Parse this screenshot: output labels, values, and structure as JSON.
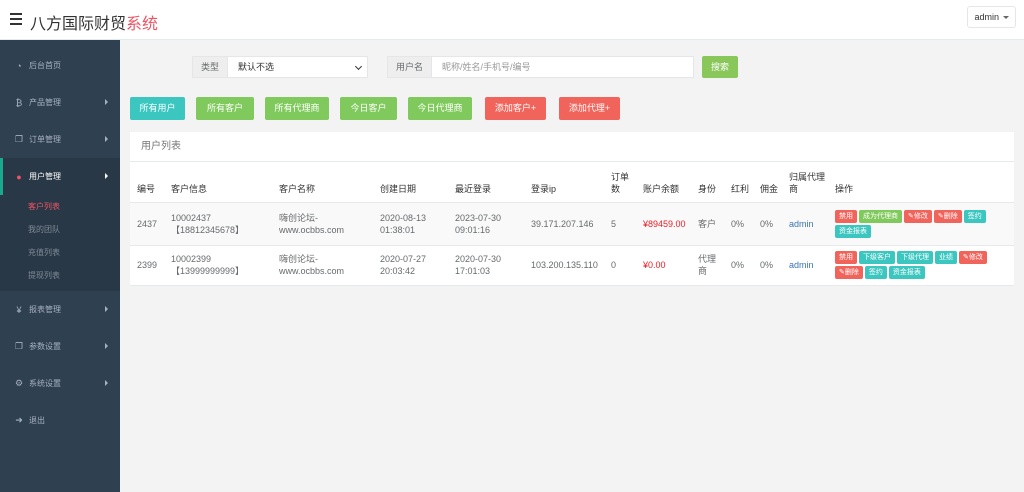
{
  "header": {
    "brand_main": "八方国际财贸",
    "brand_accent": "系统",
    "user": "admin"
  },
  "sidebar": {
    "items": [
      {
        "icon": "dashboard-icon",
        "glyph": "◔",
        "label": "后台首页"
      },
      {
        "icon": "bitcoin-icon",
        "glyph": "₿",
        "label": "产品管理"
      },
      {
        "icon": "copy-icon",
        "glyph": "❐",
        "label": "订单管理"
      },
      {
        "icon": "user-icon",
        "glyph": "●",
        "label": "用户管理"
      },
      {
        "icon": "yen-icon",
        "glyph": "¥",
        "label": "报表管理"
      },
      {
        "icon": "copy-icon",
        "glyph": "❐",
        "label": "参数设置"
      },
      {
        "icon": "gears-icon",
        "glyph": "⚙",
        "label": "系统设置"
      },
      {
        "icon": "sign-out-icon",
        "glyph": "➜",
        "label": "退出"
      }
    ],
    "subitems": [
      "客户列表",
      "我的团队",
      "充值列表",
      "提现列表"
    ]
  },
  "filters": {
    "type_label": "类型",
    "type_value": "默认不选",
    "username_label": "用户名",
    "username_placeholder": "昵称/姓名/手机号/编号",
    "search_label": "搜索"
  },
  "quick_buttons": [
    "所有用户",
    "所有客户",
    "所有代理商",
    "今日客户",
    "今日代理商",
    "添加客户+",
    "添加代理+"
  ],
  "panel": {
    "title": "用户列表",
    "columns": [
      "编号",
      "客户信息",
      "客户名称",
      "创建日期",
      "最近登录",
      "登录ip",
      "订单数",
      "账户余额",
      "身份",
      "红利",
      "佣金",
      "归属代理商",
      "操作"
    ],
    "rows": [
      {
        "id": "2437",
        "info_code": "10002437",
        "info_phone": "【18812345678】",
        "name_line1": "嗨创论坛-",
        "name_line2": "www.ocbbs.com",
        "created_date": "2020-08-13",
        "created_time": "01:38:01",
        "login_date": "2023-07-30",
        "login_time": "09:01:16",
        "ip": "39.171.207.146",
        "orders": "5",
        "balance": "¥89459.00",
        "role": "客户",
        "bonus": "0%",
        "commission": "0%",
        "agent": "admin",
        "actions": [
          "禁用",
          "成为代理商",
          "✎修改",
          "✎删除",
          "签约",
          "资金报表"
        ]
      },
      {
        "id": "2399",
        "info_code": "10002399",
        "info_phone": "【13999999999】",
        "name_line1": "嗨创论坛-",
        "name_line2": "www.ocbbs.com",
        "created_date": "2020-07-27",
        "created_time": "20:03:42",
        "login_date": "2020-07-30",
        "login_time": "17:01:03",
        "ip": "103.200.135.110",
        "orders": "0",
        "balance": "¥0.00",
        "role": "代理商",
        "bonus": "0%",
        "commission": "0%",
        "agent": "admin",
        "actions": [
          "禁用",
          "下级客户",
          "下级代理",
          "业绩",
          "✎修改",
          "✎删除",
          "签约",
          "资金报表"
        ]
      }
    ]
  }
}
